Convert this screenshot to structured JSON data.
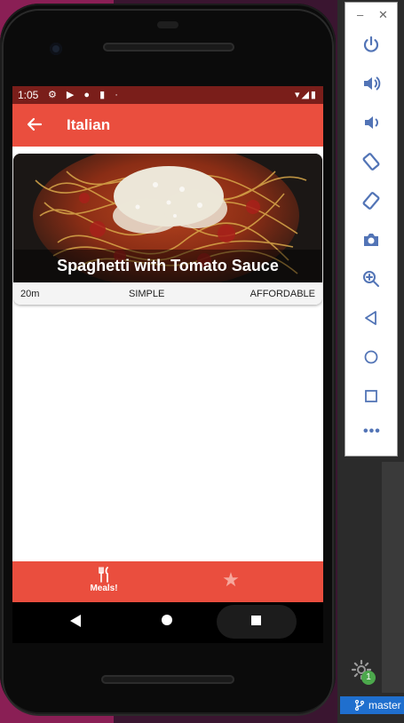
{
  "status_bar": {
    "time": "1:05"
  },
  "app_bar": {
    "title": "Italian",
    "back_icon": "arrow-left-icon"
  },
  "meal": {
    "title": "Spaghetti with Tomato Sauce",
    "duration": "20m",
    "complexity": "SIMPLE",
    "affordability": "AFFORDABLE"
  },
  "bottom_nav": {
    "meals_label": "Meals!",
    "meals_icon": "fork-knife-icon",
    "favorites_icon": "star-icon"
  },
  "emulator_panel": {
    "buttons": [
      "power-icon",
      "volume-up-icon",
      "volume-down-icon",
      "rotate-left-icon",
      "rotate-right-icon",
      "camera-icon",
      "zoom-in-icon",
      "back-triangle-icon",
      "home-circle-icon",
      "overview-square-icon"
    ],
    "more": "•••"
  },
  "ide": {
    "gear_badge": "1",
    "git_branch": "master"
  },
  "colors": {
    "app_bar": "#ea4e3e",
    "status_bar": "#7a1e1a",
    "favorite_star": "#f6a79c"
  }
}
